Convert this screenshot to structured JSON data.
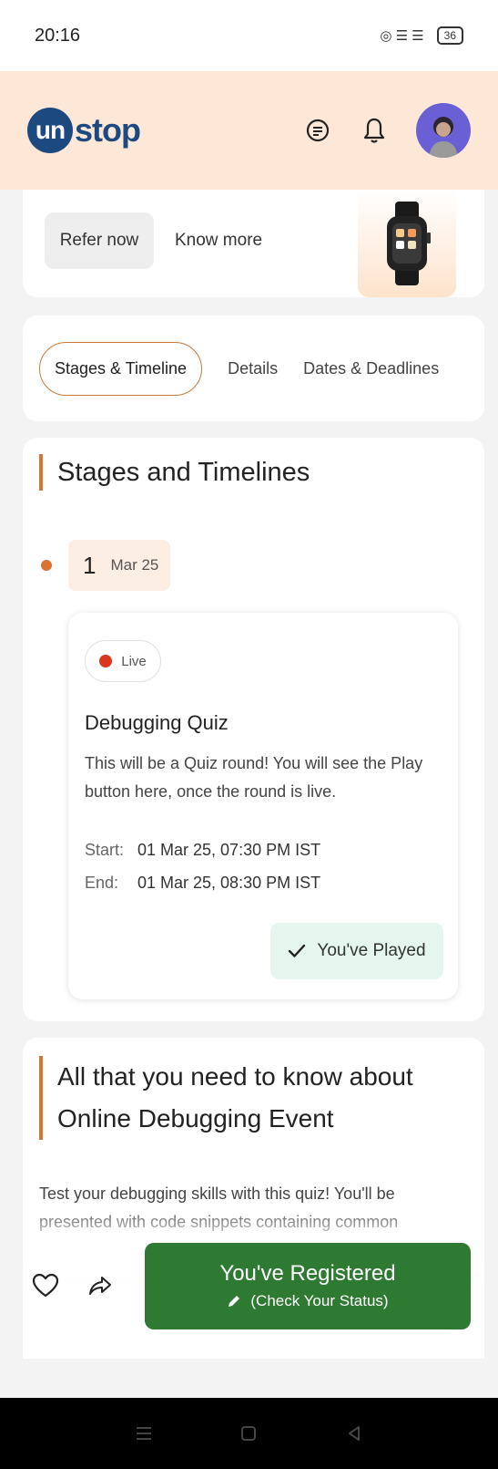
{
  "status_bar": {
    "time": "20:16",
    "icons": "◎ ☰ ☰",
    "battery": "36"
  },
  "header": {
    "logo_highlight": "un",
    "logo_rest": "stop",
    "icons": [
      "chat-icon",
      "bell-icon",
      "avatar"
    ]
  },
  "refer": {
    "refer_label": "Refer now",
    "know_more_label": "Know more"
  },
  "tabs": [
    {
      "label": "Stages & Timeline",
      "active": true
    },
    {
      "label": "Details",
      "active": false
    },
    {
      "label": "Dates & Deadlines",
      "active": false
    }
  ],
  "stages": {
    "title": "Stages and Timelines",
    "round": {
      "number": "1",
      "date": "Mar 25",
      "status": "Live",
      "title": "Debugging Quiz",
      "description": "This will be a Quiz round! You will see the Play button here, once the round is live.",
      "start_label": "Start:",
      "start_value": "01 Mar 25, 07:30 PM IST",
      "end_label": "End:",
      "end_value": "01 Mar 25, 08:30 PM IST",
      "played_label": "You've Played"
    }
  },
  "about": {
    "title": "All that you need to know about Online Debugging Event",
    "description": "Test your debugging skills with this quiz! You'll be presented with code snippets containing common"
  },
  "bottom": {
    "register_label": "You've Registered",
    "status_label": "(Check Your Status)"
  },
  "colors": {
    "accent": "#d97331",
    "brand": "#1c4980",
    "header_bg": "#fde8d8",
    "register_bg": "#2f7a33",
    "played_bg": "#e4f6ee",
    "live": "#d9381e"
  }
}
